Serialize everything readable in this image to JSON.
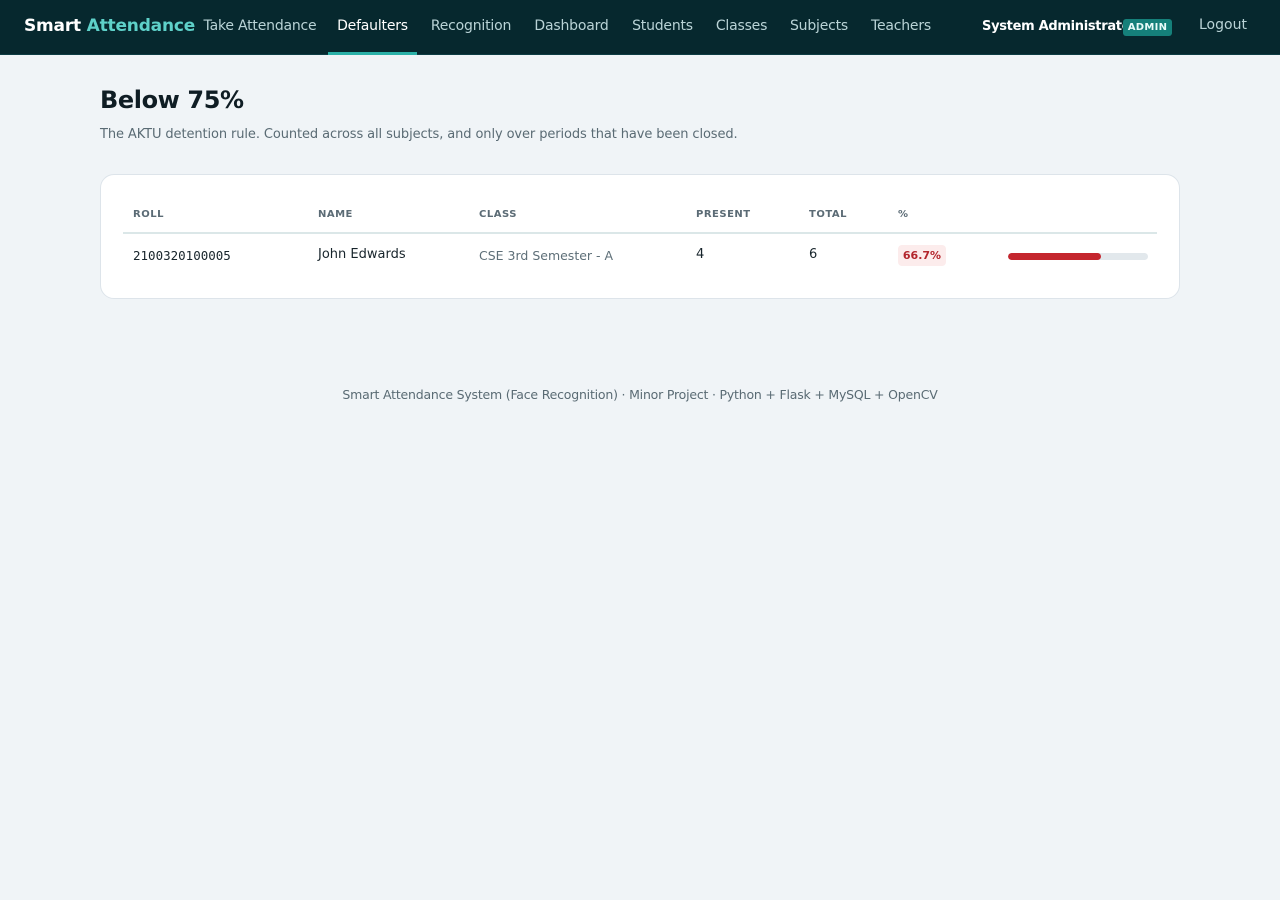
{
  "brand": {
    "part1": "Smart",
    "part2": "Attendance"
  },
  "nav": {
    "items": [
      {
        "label": "Take Attendance",
        "active": false
      },
      {
        "label": "Defaulters",
        "active": true
      },
      {
        "label": "Recognition",
        "active": false
      },
      {
        "label": "Dashboard",
        "active": false
      },
      {
        "label": "Students",
        "active": false
      },
      {
        "label": "Classes",
        "active": false
      },
      {
        "label": "Subjects",
        "active": false
      },
      {
        "label": "Teachers",
        "active": false
      }
    ]
  },
  "user": {
    "name": "System Administrator",
    "role_badge": "ADMIN",
    "logout_label": "Logout"
  },
  "page": {
    "title": "Below 75%",
    "subtitle": "The AKTU detention rule. Counted across all subjects, and only over periods that have been closed."
  },
  "table": {
    "columns": [
      "ROLL",
      "NAME",
      "CLASS",
      "PRESENT",
      "TOTAL",
      "%"
    ],
    "rows": [
      {
        "roll": "2100320100005",
        "name": "John Edwards",
        "class": "CSE 3rd Semester - A",
        "present": "4",
        "total": "6",
        "percent": "66.7%",
        "percent_value": 66.7
      }
    ]
  },
  "footer": {
    "text": "Smart Attendance System (Face Recognition) · Minor Project · Python + Flask + MySQL + OpenCV"
  },
  "colors": {
    "topbar_bg": "#06282e",
    "accent": "#2bb1a8",
    "brand_accent": "#5ed1c9",
    "danger": "#c4262e",
    "page_bg": "#f0f4f7"
  }
}
